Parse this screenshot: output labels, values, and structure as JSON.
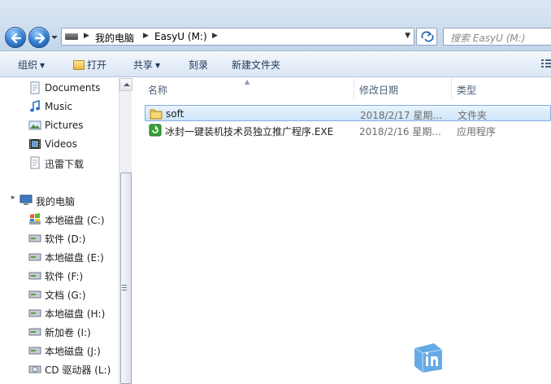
{
  "address_bar": {
    "crumbs": [
      "我的电脑",
      "EasyU (M:)"
    ],
    "search_placeholder": "搜索 EasyU (M:)"
  },
  "toolbar": {
    "organize": "组织",
    "open": "打开",
    "share": "共享",
    "burn": "刻录",
    "new_folder": "新建文件夹"
  },
  "nav_pane": {
    "favorites": [
      {
        "label": "Documents",
        "icon": "documents-icon"
      },
      {
        "label": "Music",
        "icon": "music-icon"
      },
      {
        "label": "Pictures",
        "icon": "pictures-icon"
      },
      {
        "label": "Videos",
        "icon": "videos-icon"
      },
      {
        "label": "迅雷下载",
        "icon": "download-folder-icon"
      }
    ],
    "computer": {
      "label": "我的电脑",
      "icon": "computer-icon"
    },
    "drives": [
      {
        "label": "本地磁盘 (C:)",
        "icon": "system-drive-icon"
      },
      {
        "label": "软件 (D:)",
        "icon": "drive-icon"
      },
      {
        "label": "本地磁盘 (E:)",
        "icon": "drive-icon"
      },
      {
        "label": "软件 (F:)",
        "icon": "drive-icon"
      },
      {
        "label": "文档 (G:)",
        "icon": "drive-icon"
      },
      {
        "label": "本地磁盘 (H:)",
        "icon": "drive-icon"
      },
      {
        "label": "新加卷 (I:)",
        "icon": "drive-icon"
      },
      {
        "label": "本地磁盘 (J:)",
        "icon": "drive-icon"
      },
      {
        "label": "CD 驱动器 (L:)",
        "icon": "cd-drive-icon"
      }
    ]
  },
  "file_list": {
    "headers": {
      "name": "名称",
      "date": "修改日期",
      "type": "类型"
    },
    "rows": [
      {
        "name": "soft",
        "date": "2018/2/17 星期...",
        "type": "文件夹",
        "icon": "folder-icon",
        "selected": true
      },
      {
        "name": "冰封一键装机技术员独立推广程序.EXE",
        "date": "2018/2/16 星期...",
        "type": "应用程序",
        "icon": "exe-icon",
        "selected": false
      }
    ]
  },
  "colors": {
    "selection": "#cce4f9",
    "toolbar_text": "#1e395b",
    "header_text": "#4c607a"
  }
}
